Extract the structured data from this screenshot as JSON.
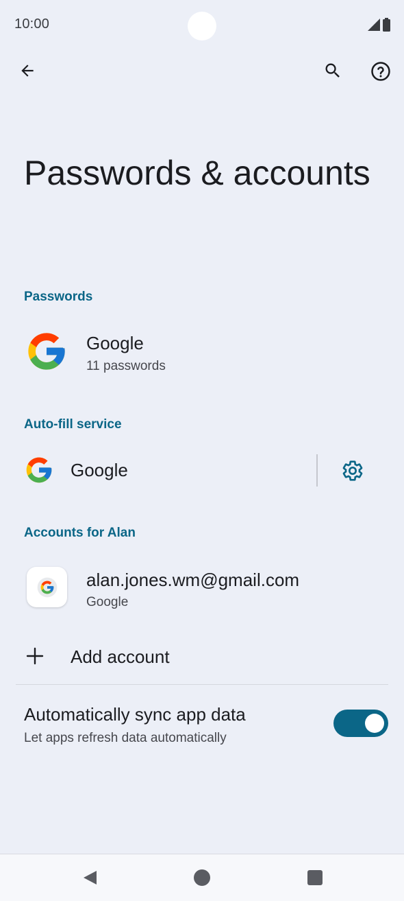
{
  "status_bar": {
    "time": "10:00",
    "signal_icon": "signal-icon",
    "battery_icon": "battery-icon"
  },
  "toolbar": {
    "back_icon": "arrow-back-icon",
    "search_icon": "search-icon",
    "help_icon": "help-icon"
  },
  "page": {
    "title": "Passwords & accounts"
  },
  "passwords": {
    "header": "Passwords",
    "item": {
      "title": "Google",
      "subtitle": "11 passwords",
      "icon": "google-g-icon"
    }
  },
  "autofill": {
    "header": "Auto-fill service",
    "item": {
      "title": "Google",
      "icon": "google-g-icon",
      "settings_icon": "gear-icon"
    }
  },
  "accounts": {
    "header": "Accounts for Alan",
    "items": [
      {
        "title": "alan.jones.wm@gmail.com",
        "subtitle": "Google",
        "icon": "google-g-icon"
      }
    ],
    "add_label": "Add account",
    "add_icon": "plus-icon"
  },
  "sync": {
    "title": "Automatically sync app data",
    "subtitle": "Let apps refresh data automatically",
    "enabled": true
  },
  "colors": {
    "accent": "#0b6687",
    "background": "#eceff7"
  },
  "nav_bar": {
    "back_icon": "nav-back-icon",
    "home_icon": "nav-home-icon",
    "recents_icon": "nav-recents-icon"
  }
}
